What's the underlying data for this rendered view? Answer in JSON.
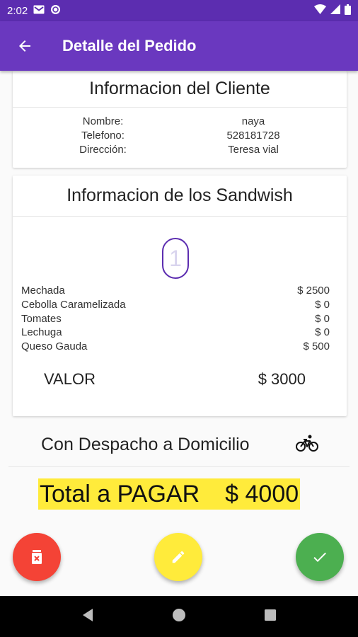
{
  "status_bar": {
    "time": "2:02"
  },
  "app_bar": {
    "title": "Detalle del Pedido"
  },
  "cliente": {
    "title": "Informacion del Cliente",
    "rows": [
      {
        "label": "Nombre:",
        "value": "naya"
      },
      {
        "label": "Telefono:",
        "value": "528181728"
      },
      {
        "label": "Dirección:",
        "value": "Teresa vial"
      }
    ]
  },
  "sandwish": {
    "title": "Informacion de los Sandwish",
    "quantity": "1",
    "items": [
      {
        "name": "Mechada",
        "price": "$ 2500"
      },
      {
        "name": "Cebolla Caramelizada",
        "price": "$ 0"
      },
      {
        "name": "Tomates",
        "price": "$ 0"
      },
      {
        "name": "Lechuga",
        "price": "$ 0"
      },
      {
        "name": "Queso Gauda",
        "price": "$ 500"
      }
    ],
    "valor_label": "VALOR",
    "valor_amount": "$ 3000"
  },
  "despacho": {
    "label": "Con Despacho a Domicilio",
    "icon": "bicycle-icon"
  },
  "total": {
    "label": "Total a PAGAR",
    "amount": "$ 4000"
  },
  "actions": {
    "delete_icon": "trash-icon",
    "edit_icon": "pencil-icon",
    "confirm_icon": "check-icon"
  },
  "colors": {
    "primary": "#6a38bf",
    "status_bar": "#5c2db0",
    "highlight": "#ffeb3b",
    "delete": "#f44336",
    "confirm": "#4caf50"
  }
}
